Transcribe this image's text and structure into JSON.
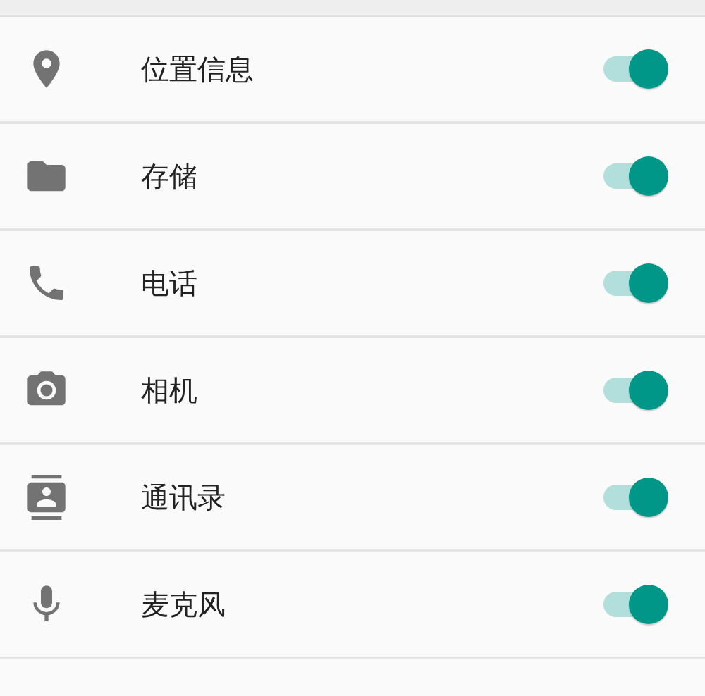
{
  "permissions": [
    {
      "kind": "location",
      "label": "位置信息",
      "on": true
    },
    {
      "kind": "storage",
      "label": "存储",
      "on": true
    },
    {
      "kind": "phone",
      "label": "电话",
      "on": true
    },
    {
      "kind": "camera",
      "label": "相机",
      "on": true
    },
    {
      "kind": "contacts",
      "label": "通讯录",
      "on": true
    },
    {
      "kind": "microphone",
      "label": "麦克风",
      "on": true
    }
  ]
}
